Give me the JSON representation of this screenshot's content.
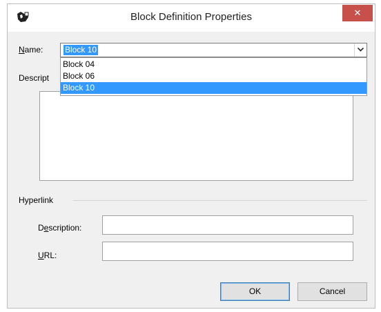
{
  "window": {
    "title": "Block Definition Properties",
    "close_glyph": "✕"
  },
  "name_field": {
    "label_key": "N",
    "label_rest": "ame:",
    "value": "Block 10",
    "options": [
      "Block 04",
      "Block 06",
      "Block 10"
    ],
    "selected_index": 2
  },
  "description": {
    "label": "Descript"
  },
  "hyperlink": {
    "group_label": "Hyperlink",
    "desc_label_pre": "D",
    "desc_label_key": "e",
    "desc_label_rest": "scription:",
    "url_label_key": "U",
    "url_label_rest": "RL:"
  },
  "buttons": {
    "ok": "OK",
    "cancel": "Cancel"
  },
  "colors": {
    "selection": "#3399ff",
    "close": "#c7504b",
    "client_bg": "#f0f0f0"
  }
}
